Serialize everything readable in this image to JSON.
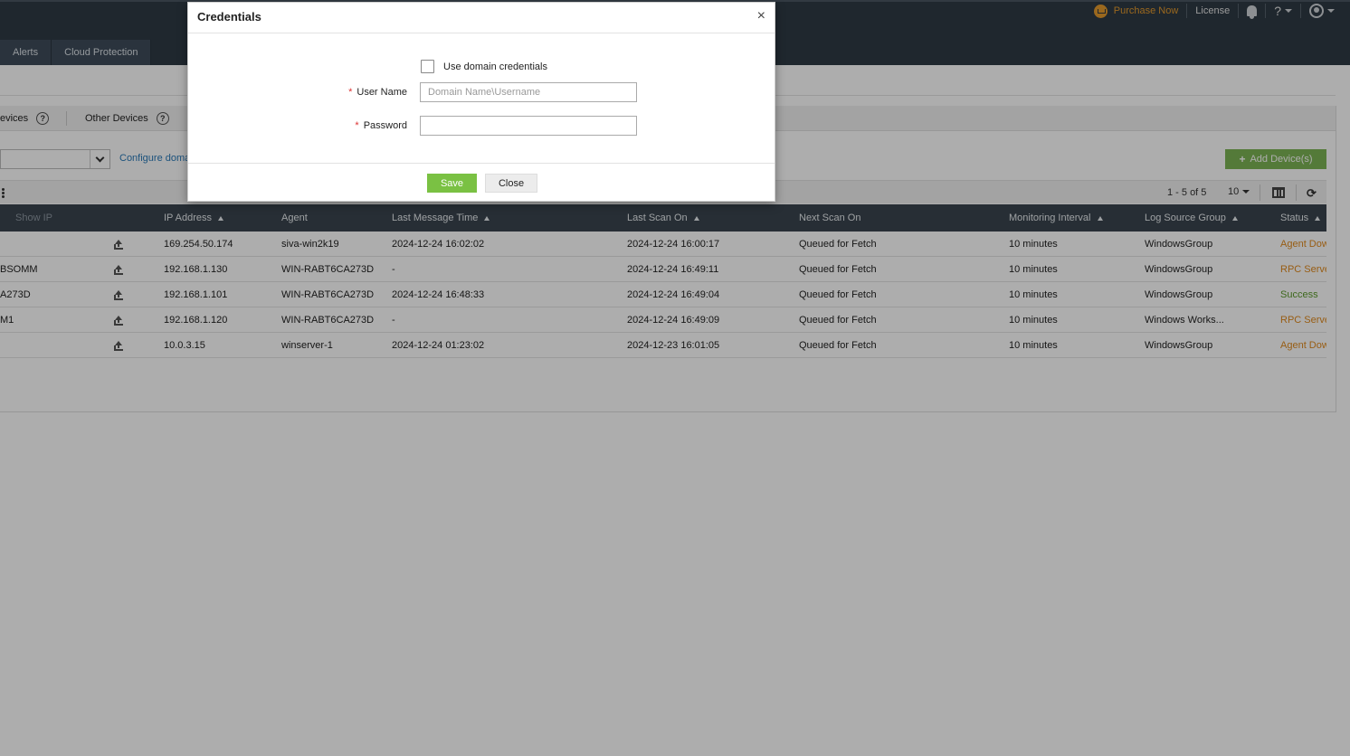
{
  "header": {
    "purchase_label": "Purchase Now",
    "license_label": "License",
    "help_label": "?",
    "nav_tabs": [
      {
        "label": "Alerts"
      },
      {
        "label": "Cloud Protection"
      }
    ]
  },
  "subtabs": [
    {
      "label": "evices"
    },
    {
      "label": "Other Devices"
    }
  ],
  "help_glyph": "?",
  "filter": {
    "configure_link": "Configure domai"
  },
  "add_button": {
    "icon": "plus-icon",
    "label": "Add Device(s)"
  },
  "pagination": {
    "range": "1 - 5 of 5",
    "page_size": "10"
  },
  "table": {
    "columns": [
      {
        "label": "Show IP",
        "sortable": false
      },
      {
        "label": "IP Address",
        "sortable": true
      },
      {
        "label": "Agent",
        "sortable": false
      },
      {
        "label": "Last Message Time",
        "sortable": true
      },
      {
        "label": "Last Scan On",
        "sortable": true
      },
      {
        "label": "Next Scan On",
        "sortable": false
      },
      {
        "label": "Monitoring Interval",
        "sortable": true
      },
      {
        "label": "Log Source Group",
        "sortable": true
      },
      {
        "label": "Status",
        "sortable": true
      }
    ],
    "rows": [
      {
        "name": "",
        "ip": "169.254.50.174",
        "agent": "siva-win2k19",
        "last_message": "2024-12-24 16:02:02",
        "last_scan": "2024-12-24 16:00:17",
        "next_scan": "Queued for Fetch",
        "interval": "10 minutes",
        "group": "WindowsGroup",
        "status": "Agent Dow",
        "status_type": "warn"
      },
      {
        "name": "BSOMM",
        "ip": "192.168.1.130",
        "agent": "WIN-RABT6CA273D",
        "last_message": "-",
        "last_scan": "2024-12-24 16:49:11",
        "next_scan": "Queued for Fetch",
        "interval": "10 minutes",
        "group": "WindowsGroup",
        "status": "RPC Serve",
        "status_type": "warn"
      },
      {
        "name": "A273D",
        "ip": "192.168.1.101",
        "agent": "WIN-RABT6CA273D",
        "last_message": "2024-12-24 16:48:33",
        "last_scan": "2024-12-24 16:49:04",
        "next_scan": "Queued for Fetch",
        "interval": "10 minutes",
        "group": "WindowsGroup",
        "status": "Success",
        "status_type": "ok"
      },
      {
        "name": "M1",
        "ip": "192.168.1.120",
        "agent": "WIN-RABT6CA273D",
        "last_message": "-",
        "last_scan": "2024-12-24 16:49:09",
        "next_scan": "Queued for Fetch",
        "interval": "10 minutes",
        "group": "Windows Works...",
        "status": "RPC Serve",
        "status_type": "warn"
      },
      {
        "name": "",
        "ip": "10.0.3.15",
        "agent": "winserver-1",
        "last_message": "2024-12-24 01:23:02",
        "last_scan": "2024-12-23 16:01:05",
        "next_scan": "Queued for Fetch",
        "interval": "10 minutes",
        "group": "WindowsGroup",
        "status": "Agent Dow",
        "status_type": "warn"
      }
    ]
  },
  "modal": {
    "title": "Credentials",
    "close_glyph": "×",
    "use_domain_label": "Use domain credentials",
    "use_domain_checked": false,
    "required_mark": "*",
    "username_label": "User Name",
    "username_value": "",
    "username_placeholder": "Domain Name\\Username",
    "password_label": "Password",
    "password_value": "",
    "save_label": "Save",
    "close_label": "Close"
  },
  "colors": {
    "accent_green": "#7ac143",
    "warn_orange": "#e08a1e",
    "header_bg": "#2f3a45"
  }
}
